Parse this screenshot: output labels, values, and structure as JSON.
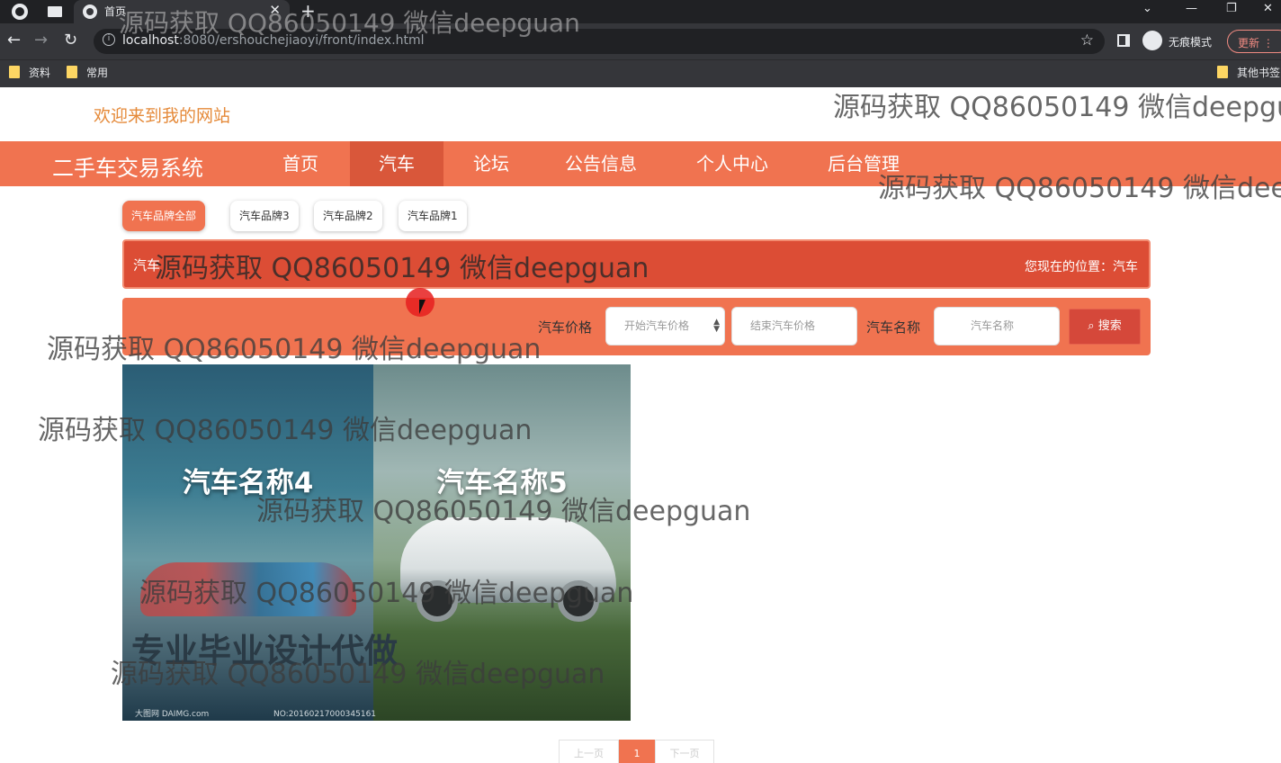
{
  "browser": {
    "tab_title": "首页",
    "url_host": "localhost",
    "url_rest": ":8080/ershouchejiaoyi/front/index.html",
    "incognito_label": "无痕模式",
    "update_label": "更新",
    "bookmarks": [
      "资料",
      "常用"
    ],
    "other_bookmarks": "其他书签"
  },
  "site": {
    "welcome": "欢迎来到我的网站",
    "brand": "二手车交易系统",
    "nav": [
      "首页",
      "汽车",
      "论坛",
      "公告信息",
      "个人中心",
      "后台管理"
    ],
    "active_nav": "汽车"
  },
  "filters": {
    "brand_tabs": [
      "汽车品牌全部",
      "汽车品牌3",
      "汽车品牌2",
      "汽车品牌1"
    ]
  },
  "section": {
    "title": "汽车",
    "location": "您现在的位置：汽车"
  },
  "search": {
    "price_label": "汽车价格",
    "start_price_placeholder": "开始汽车价格",
    "end_price_placeholder": "结束汽车价格",
    "name_label": "汽车名称",
    "name_placeholder": "汽车名称",
    "button": "搜索"
  },
  "products": [
    {
      "name": "汽车名称4"
    },
    {
      "name": "汽车名称5"
    }
  ],
  "image_overlay": {
    "promo": "专业毕业设计代做",
    "source": "大图网 DAIMG.com",
    "number": "NO:20160217000345161"
  },
  "pagination": {
    "prev": "上一页",
    "current": "1",
    "next": "下一页"
  },
  "watermark": "源码获取 QQ86050149 微信deepguan",
  "colors": {
    "primary": "#f07350",
    "active": "#d9573a",
    "crumb": "#dc4d35"
  }
}
